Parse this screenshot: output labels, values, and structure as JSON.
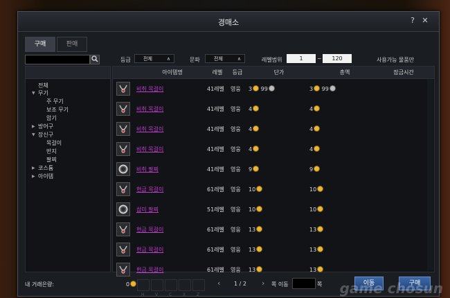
{
  "window": {
    "title": "경매소",
    "help": "?",
    "close": "✕"
  },
  "tabs": [
    {
      "label": "구매"
    },
    {
      "label": "판매"
    }
  ],
  "filters": {
    "search_value": "",
    "grade_label": "등급",
    "grade_value": "전체",
    "faction_label": "문파",
    "faction_value": "전체",
    "level_label": "레벨범위",
    "level_min": "1",
    "level_sep": "~",
    "level_max": "120",
    "usable_only": "사용가능 물품만"
  },
  "sidebar": {
    "items": [
      {
        "label": "전체"
      },
      {
        "label": "무기"
      },
      {
        "label": "주 무기"
      },
      {
        "label": "보조 무기"
      },
      {
        "label": "암기"
      },
      {
        "label": "방어구"
      },
      {
        "label": "장신구"
      },
      {
        "label": "목걸이"
      },
      {
        "label": "반지"
      },
      {
        "label": "팔찌"
      },
      {
        "label": "코스튬"
      },
      {
        "label": "아이템"
      }
    ]
  },
  "table": {
    "headers": [
      "아이템명",
      "레벨",
      "등급",
      "단가",
      "총액",
      "잠금시간"
    ],
    "rows": [
      {
        "name": "비취 목걸이",
        "level": "41레벨",
        "grade": "영웅",
        "unit_gold": "3",
        "unit_silver": "99",
        "total_gold": "3",
        "total_silver": "99",
        "icon": "necklace-icon"
      },
      {
        "name": "비취 목걸이",
        "level": "41레벨",
        "grade": "영웅",
        "unit_gold": "4",
        "total_gold": "4",
        "icon": "necklace-icon"
      },
      {
        "name": "비취 목걸이",
        "level": "41레벨",
        "grade": "영웅",
        "unit_gold": "4",
        "total_gold": "4",
        "icon": "necklace-icon"
      },
      {
        "name": "비취 목걸이",
        "level": "41레벨",
        "grade": "영웅",
        "unit_gold": "4",
        "total_gold": "4",
        "icon": "necklace-icon"
      },
      {
        "name": "비취 팔찌",
        "level": "41레벨",
        "grade": "영웅",
        "unit_gold": "9",
        "total_gold": "9",
        "icon": "bracelet-icon"
      },
      {
        "name": "현금 목걸이",
        "level": "61레벨",
        "grade": "영웅",
        "unit_gold": "10",
        "total_gold": "10",
        "icon": "necklace-icon"
      },
      {
        "name": "삼미 팔찌",
        "level": "51레벨",
        "grade": "영웅",
        "unit_gold": "10",
        "total_gold": "10",
        "icon": "bracelet-icon"
      },
      {
        "name": "현금 목걸이",
        "level": "61레벨",
        "grade": "영웅",
        "unit_gold": "13",
        "total_gold": "13",
        "icon": "necklace-icon"
      },
      {
        "name": "현금 목걸이",
        "level": "61레벨",
        "grade": "영웅",
        "unit_gold": "13",
        "total_gold": "13",
        "icon": "necklace-icon"
      },
      {
        "name": "현금 목걸이",
        "level": "61레벨",
        "grade": "영웅",
        "unit_gold": "13",
        "total_gold": "13",
        "icon": "necklace-icon"
      }
    ]
  },
  "footer": {
    "trade_label": "내 거래은량:",
    "trade_value": "0",
    "page_prev": "‹",
    "page": "1 / 2",
    "page_next": "›",
    "jump_label": "쪽 이동",
    "jump_value": "",
    "jump_suffix": "쪽",
    "move_button": "이동",
    "buy_button": "구매",
    "hotkeys": [
      "H",
      "V",
      "C",
      "X",
      "Z"
    ]
  },
  "watermark": "game chosun",
  "colors": {
    "item_hero": "#c33ad0",
    "gold": "#e8b83a",
    "button": "#3c69a8"
  }
}
